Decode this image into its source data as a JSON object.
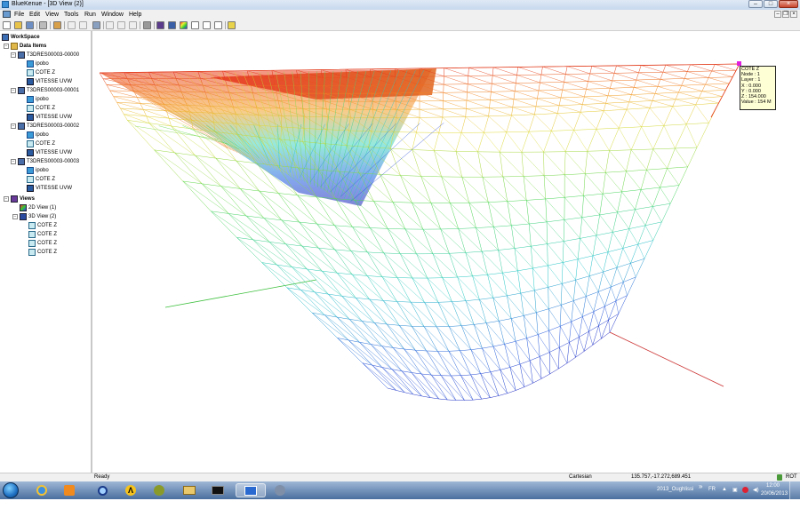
{
  "window": {
    "title": "BlueKenue - [3D View (2)]"
  },
  "menu": [
    "File",
    "Edit",
    "View",
    "Tools",
    "Run",
    "Window",
    "Help"
  ],
  "workspace": {
    "title": "WorkSpace",
    "data_items_label": "Data Items",
    "datasets": [
      {
        "name": "T3DRES00003-00000",
        "children": [
          "ipobo",
          "COTE Z",
          "VITESSE UVW"
        ]
      },
      {
        "name": "T3DRES00003-00001",
        "children": [
          "ipobo",
          "COTE Z",
          "VITESSE UVW"
        ]
      },
      {
        "name": "T3DRES00003-00002",
        "children": [
          "ipobo",
          "COTE Z",
          "VITESSE UVW"
        ]
      },
      {
        "name": "T3DRES00003-00003",
        "children": [
          "ipobo",
          "COTE Z",
          "VITESSE UVW"
        ]
      }
    ],
    "views_label": "Views",
    "views": [
      {
        "name": "2D View (1)",
        "children": []
      },
      {
        "name": "3D View (2)",
        "children": [
          "COTE Z",
          "COTE Z",
          "COTE Z",
          "COTE Z"
        ]
      }
    ]
  },
  "probe": {
    "title": "COTE Z",
    "lines": [
      "Node : 1",
      "Layer : 1",
      "X : 0.000",
      "Y : 0.000",
      "Z : 154.000",
      "Value : 154 M"
    ]
  },
  "status": {
    "ready": "Ready",
    "coord_system": "Cartesian",
    "cursor": "135.757,-17.272,689.451",
    "mode": "ROT"
  },
  "taskbar": {
    "window_label": "2013_Oughlissi",
    "lang": "FR",
    "time": "12:00",
    "date": "20/06/2013"
  },
  "colors": {
    "mesh_top": "#e23a1a",
    "mesh_mid": "#3fd46a",
    "mesh_bottom": "#1a2fd0",
    "axis_x": "#cc3333",
    "axis_y": "#3cbf3c",
    "probe_marker": "#e020e0"
  }
}
